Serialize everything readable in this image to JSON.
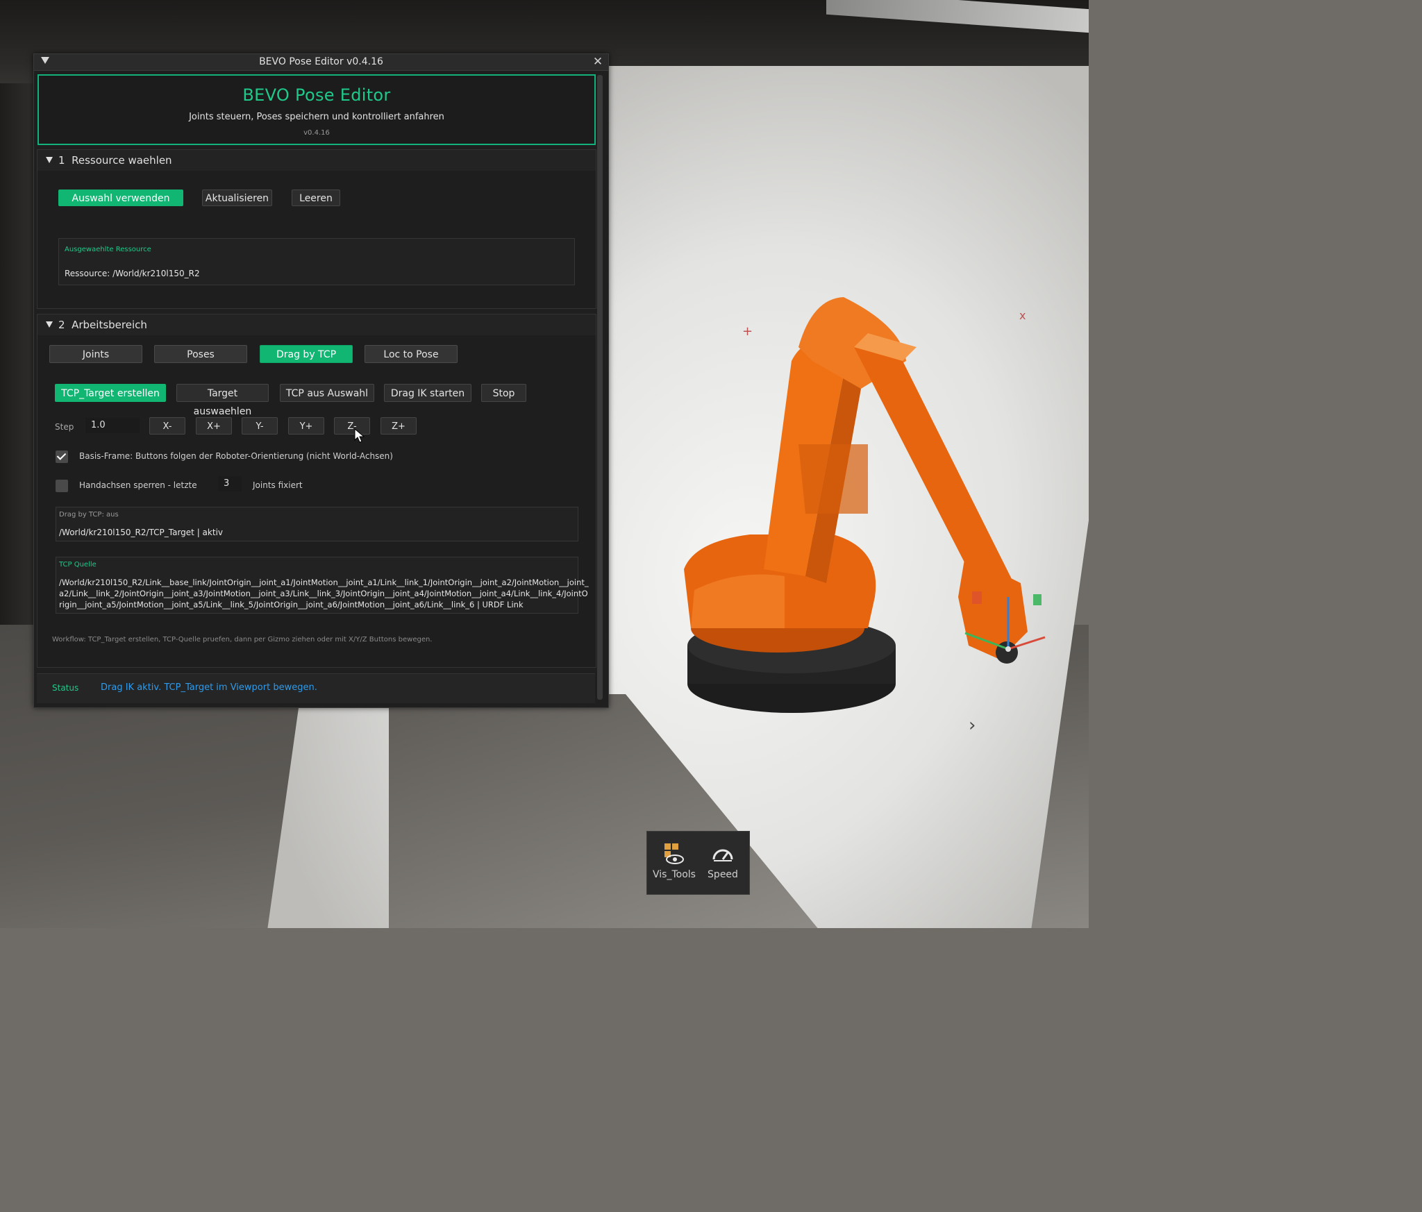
{
  "window": {
    "title": "BEVO Pose Editor v0.4.16",
    "close_glyph": "✕"
  },
  "header": {
    "title": "BEVO Pose Editor",
    "subtitle": "Joints steuern, Poses speichern und kontrolliert anfahren",
    "version": "v0.4.16"
  },
  "section1": {
    "number": "1",
    "title": "Ressource waehlen",
    "buttons": {
      "use_selection": "Auswahl verwenden",
      "refresh": "Aktualisieren",
      "clear": "Leeren"
    },
    "selected_box": {
      "label": "Ausgewaehlte Ressource",
      "value": "Ressource: /World/kr210l150_R2"
    }
  },
  "section2": {
    "number": "2",
    "title": "Arbeitsbereich",
    "tabs": [
      {
        "label": "Joints",
        "active": false
      },
      {
        "label": "Poses",
        "active": false
      },
      {
        "label": "Drag by TCP",
        "active": true
      },
      {
        "label": "Loc to Pose",
        "active": false
      }
    ],
    "actions": {
      "create_target": "TCP_Target erstellen",
      "select_target": "Target auswaehlen",
      "tcp_from_selection": "TCP aus Auswahl",
      "start_drag_ik": "Drag IK starten",
      "stop": "Stop"
    },
    "step": {
      "label": "Step",
      "value": "1.0",
      "buttons": [
        "X-",
        "X+",
        "Y-",
        "Y+",
        "Z-",
        "Z+"
      ]
    },
    "base_frame": {
      "checked": true,
      "label": "Basis-Frame: Buttons folgen der Roboter-Orientierung (nicht World-Achsen)"
    },
    "lock_wrist": {
      "checked": false,
      "label": "Handachsen sperren - letzte",
      "count": "3",
      "suffix": "Joints fixiert"
    },
    "drag_box": {
      "label": "Drag by TCP: aus",
      "value": "/World/kr210l150_R2/TCP_Target | aktiv"
    },
    "tcp_source": {
      "label": "TCP Quelle",
      "lines": [
        "/World/kr210l150_R2/Link__base_link/JointOrigin__joint_a1/JointMotion__joint_a1/Link__link_1/JointOrigin__joint_a2/JointMotion__joint_",
        "a2/Link__link_2/JointOrigin__joint_a3/JointMotion__joint_a3/Link__link_3/JointOrigin__joint_a4/JointMotion__joint_a4/Link__link_4/JointO",
        "rigin__joint_a5/JointMotion__joint_a5/Link__link_5/JointOrigin__joint_a6/JointMotion__joint_a6/Link__link_6 | URDF Link"
      ]
    },
    "workflow": "Workflow: TCP_Target erstellen, TCP-Quelle pruefen, dann per Gizmo ziehen oder mit X/Y/Z Buttons bewegen."
  },
  "status": {
    "label": "Status",
    "message": "Drag IK aktiv. TCP_Target im Viewport bewegen."
  },
  "viewport_toolbar": {
    "items": [
      {
        "label": "Vis_Tools",
        "icon": "visibility-tools-icon"
      },
      {
        "label": "Speed",
        "icon": "speedometer-icon"
      }
    ]
  },
  "colors": {
    "accent": "#11b673",
    "accent_text": "#1fc98a",
    "status_text": "#2f9bea",
    "robot_orange": "#e8650f"
  }
}
